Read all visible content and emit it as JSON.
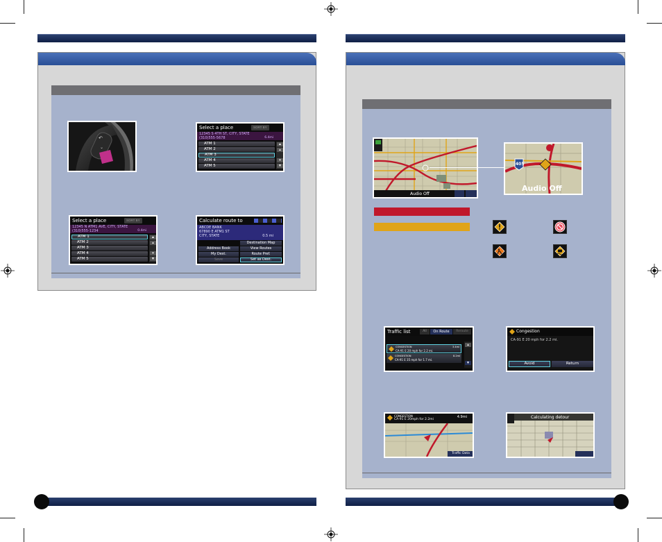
{
  "left_page": {
    "screens": {
      "place_list_1": {
        "title": "Select a place",
        "tag": "SORT BY",
        "address": "12345 S 4TH ST, CITY, STATE",
        "phone": "(310)555-5678",
        "distance": "6.4mi",
        "rows": [
          "ATM 1",
          "ATM 2",
          "ATM 3",
          "ATM 4",
          "ATM 5"
        ]
      },
      "place_list_2": {
        "title": "Select a place",
        "tag": "SORT BY",
        "address": "12345 N ATM1 AVE, CITY, STATE",
        "phone": "(310)555-1234",
        "distance": "0.4mi",
        "rows": [
          "ATM 1",
          "ATM 2",
          "ATM 3",
          "ATM 4",
          "ATM 5"
        ]
      },
      "calculate_route": {
        "title": "Calculate route to",
        "dest_name": "ABCDE BANK",
        "dest_street": "67890 E ATM1 ST",
        "dest_city": "CITY, STATE",
        "distance": "0.5 mi",
        "btn_dest_map": "Destination Map",
        "btn_address_book": "Address Book",
        "btn_view_routes": "View Routes",
        "btn_my_dest": "My Dest.",
        "btn_route_pref": "Route Pref.",
        "btn_save": "Save",
        "btn_set_dest": "Set as Dest."
      }
    }
  },
  "right_page": {
    "screens": {
      "map_overview": {
        "audio": "Audio Off"
      },
      "map_zoom": {
        "audio": "Audio Off",
        "shield": "405"
      },
      "traffic_list": {
        "title": "Traffic list",
        "tabs": [
          "All",
          "On Route",
          "Reroute"
        ],
        "items": [
          {
            "type": "CONGESTION",
            "desc": "CA-91 E 20 mph for 2.2 mi.",
            "dist": "3.4mi"
          },
          {
            "type": "CONGESTION",
            "desc": "CA-91 E 35 mph for 1.7 mi.",
            "dist": "8.2mi"
          }
        ]
      },
      "congestion_detail": {
        "title": "Congestion",
        "desc": "CA-91 E 20 mph for 2.2 mi.",
        "btn_avoid": "Avoid",
        "btn_return": "Return"
      },
      "congestion_map": {
        "type": "CONGESTION",
        "desc": "CA-91 E 20mph for 2.2mi",
        "dist": "4.9mi",
        "btn": "Traffic Data"
      },
      "detour_map": {
        "title": "Calculating detour"
      }
    },
    "legend_colors": {
      "red": "#c0182b",
      "amber": "#e0a418"
    },
    "sign_icons": [
      "warning-sign-icon",
      "no-entry-sign-icon",
      "construction-sign-icon",
      "weather-sign-icon"
    ]
  }
}
